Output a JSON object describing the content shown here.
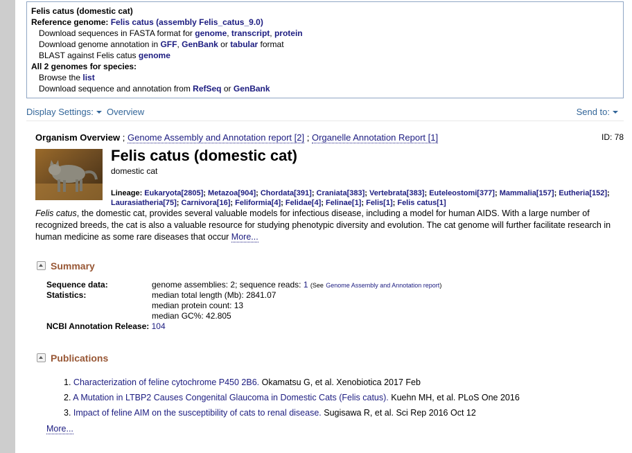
{
  "topbox": {
    "heading": "Felis catus (domestic cat)",
    "ref_label": "Reference genome:",
    "ref_link": "Felis catus (assembly Felis_catus_9.0)",
    "dl_seq_text": "Download sequences in FASTA format for",
    "dl_seq_genome": "genome",
    "dl_seq_transcript": "transcript",
    "dl_seq_protein": "protein",
    "dl_ann_text": "Download genome annotation in",
    "dl_ann_gff": "GFF",
    "dl_ann_genbank": "GenBank",
    "dl_ann_or": "or",
    "dl_ann_tabular": "tabular",
    "dl_ann_format": "format",
    "blast_text": "BLAST against Felis catus",
    "blast_link": "genome",
    "all_label": "All 2 genomes for species:",
    "browse_text": "Browse the",
    "browse_link": "list",
    "dl_from_text": "Download sequence and annotation from",
    "dl_refseq": "RefSeq",
    "dl_genbank": "GenBank"
  },
  "toolbar": {
    "display_settings": "Display Settings:",
    "overview": "Overview",
    "send_to": "Send to:"
  },
  "overview_row": {
    "label": "Organism Overview",
    "sep": ";",
    "link1": "Genome Assembly and Annotation report [2]",
    "link2": "Organelle Annotation Report [1]",
    "id": "ID: 78"
  },
  "organism": {
    "title": "Felis catus (domestic cat)",
    "common": "domestic cat",
    "lineage_label": "Lineage:",
    "lineage": [
      "Eukaryota[2805]",
      "Metazoa[904]",
      "Chordata[391]",
      "Craniata[383]",
      "Vertebrata[383]",
      "Euteleostomi[377]",
      "Mammalia[157]",
      "Eutheria[152]",
      "Laurasiatheria[75]",
      "Carnivora[16]",
      "Feliformia[4]",
      "Felidae[4]",
      "Felinae[1]",
      "Felis[1]",
      "Felis catus[1]"
    ],
    "desc_italic": "Felis catus",
    "desc": ", the domestic cat, provides several valuable models for infectious disease, including a model for human AIDS. With a large number of recognized breeds, the cat is also a valuable resource for studying phenotypic diversity and evolution. The cat genome will further facilitate research in human medicine as some rare diseases that occur",
    "more": "More..."
  },
  "summary": {
    "header": "Summary",
    "seq_label": "Sequence data:",
    "seq_value": "genome assemblies: 2; sequence reads:",
    "seq_reads": "1",
    "see_open": "(See",
    "see_link": "Genome Assembly and Annotation report",
    "see_close": ")",
    "stats_label": "Statistics:",
    "stat1": "median total length (Mb): 2841.07",
    "stat2": "median protein count: 13",
    "stat3": "median GC%: 42.805",
    "release_label": "NCBI Annotation Release:",
    "release_value": "104"
  },
  "publications": {
    "header": "Publications",
    "items": [
      {
        "num": "1.",
        "title": "Characterization of feline cytochrome P450 2B6.",
        "rest": "Okamatsu G, et al. Xenobiotica 2017 Feb"
      },
      {
        "num": "2.",
        "title": "A Mutation in LTBP2 Causes Congenital Glaucoma in Domestic Cats (Felis catus).",
        "rest": "Kuehn MH, et al. PLoS One 2016"
      },
      {
        "num": "3.",
        "title": "Impact of feline AIM on the susceptibility of cats to renal disease.",
        "rest": "Sugisawa R, et al. Sci Rep 2016 Oct 12"
      }
    ],
    "more": "More..."
  }
}
